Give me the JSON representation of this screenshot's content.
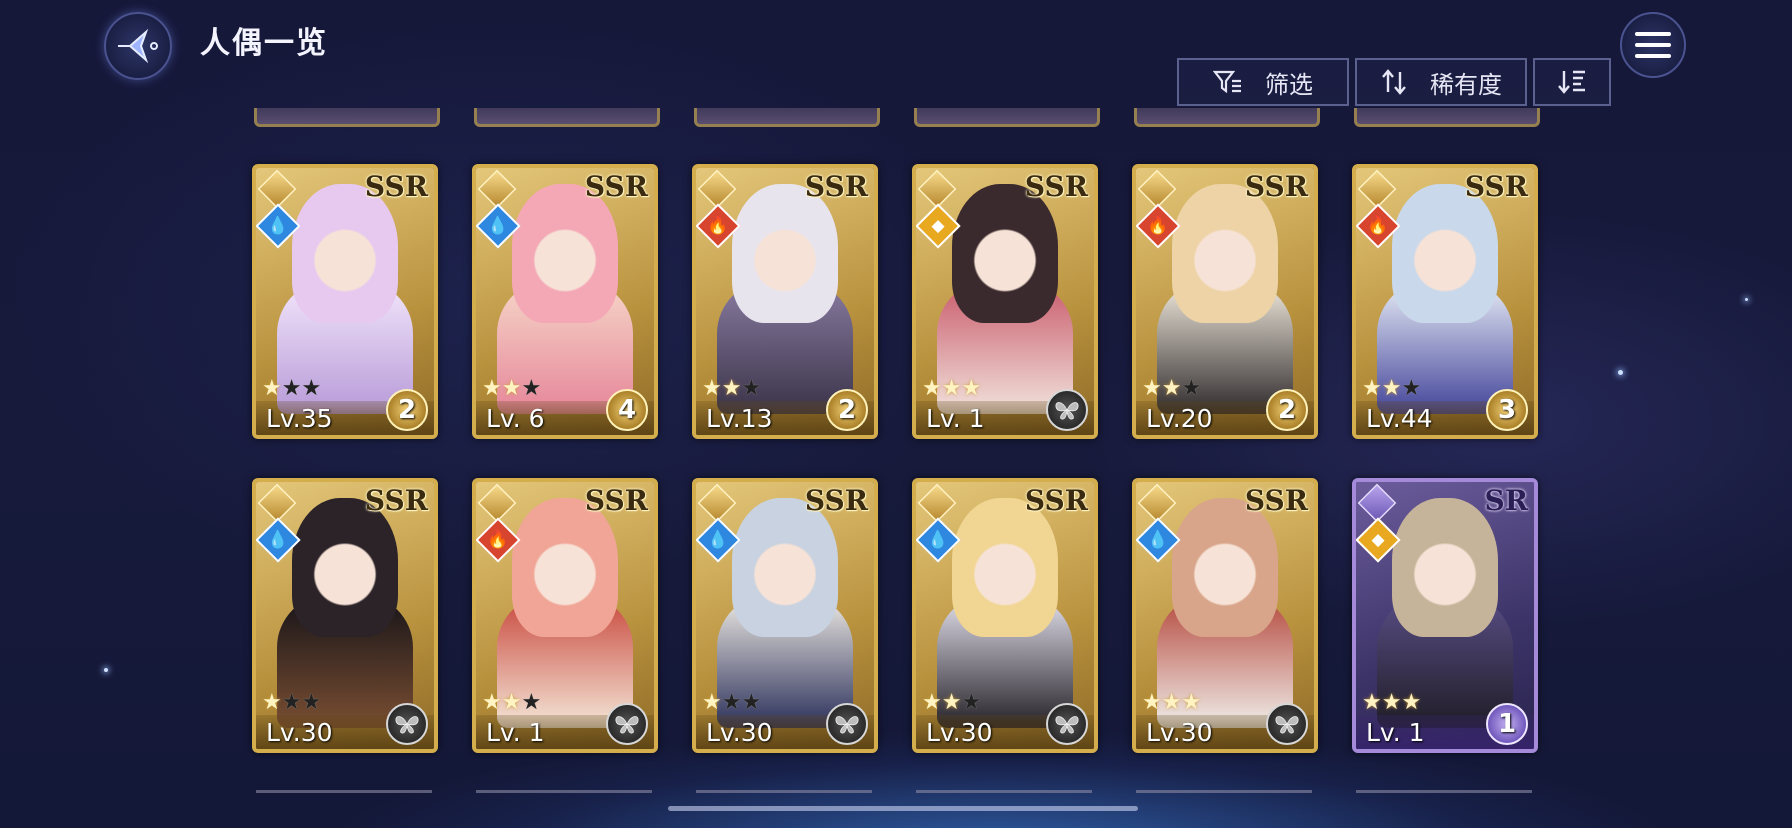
{
  "header": {
    "title": "人偶一览",
    "filter_label": "筛选",
    "sort_label": "稀有度"
  },
  "colors": {
    "ssr_frame": "#d4ae4d",
    "sr_frame": "#a48ad9",
    "water": "#2f88e0",
    "fire": "#d8452f",
    "light": "#e8a820"
  },
  "cards": [
    {
      "rarity": "SSR",
      "element": "water",
      "stars": 1,
      "max_stars": 3,
      "level": "Lv.35",
      "badge": "2",
      "badge_style": "gold",
      "palette": [
        "#e7c9f0",
        "#b79ad8",
        "#f3e7fb"
      ]
    },
    {
      "rarity": "SSR",
      "element": "water",
      "stars": 2,
      "max_stars": 3,
      "level": "Lv. 6",
      "badge": "4",
      "badge_style": "gold",
      "palette": [
        "#f4a8b6",
        "#e6869a",
        "#f6d7c8"
      ]
    },
    {
      "rarity": "SSR",
      "element": "fire",
      "stars": 2,
      "max_stars": 3,
      "level": "Lv.13",
      "badge": "2",
      "badge_style": "gold",
      "palette": [
        "#e8e4ee",
        "#3a3348",
        "#8a7ca2"
      ]
    },
    {
      "rarity": "SSR",
      "element": "light",
      "stars": 3,
      "max_stars": 3,
      "level": "Lv. 1",
      "badge": "",
      "badge_style": "gray",
      "palette": [
        "#3a2a2e",
        "#f1e3dc",
        "#c9596a"
      ]
    },
    {
      "rarity": "SSR",
      "element": "fire",
      "stars": 2,
      "max_stars": 3,
      "level": "Lv.20",
      "badge": "2",
      "badge_style": "gold",
      "palette": [
        "#edd3a5",
        "#2f2a2c",
        "#f4ede0"
      ]
    },
    {
      "rarity": "SSR",
      "element": "fire",
      "stars": 2,
      "max_stars": 3,
      "level": "Lv.44",
      "badge": "3",
      "badge_style": "gold",
      "palette": [
        "#c9d8ea",
        "#43449a",
        "#e9eef6"
      ]
    },
    {
      "rarity": "SSR",
      "element": "water",
      "stars": 1,
      "max_stars": 3,
      "level": "Lv.30",
      "badge": "",
      "badge_style": "gray",
      "palette": [
        "#2b2328",
        "#7a4e32",
        "#151318"
      ]
    },
    {
      "rarity": "SSR",
      "element": "fire",
      "stars": 2,
      "max_stars": 3,
      "level": "Lv. 1",
      "badge": "",
      "badge_style": "gray",
      "palette": [
        "#f0a596",
        "#f4e7d8",
        "#c8453a"
      ]
    },
    {
      "rarity": "SSR",
      "element": "water",
      "stars": 1,
      "max_stars": 3,
      "level": "Lv.30",
      "badge": "",
      "badge_style": "gray",
      "palette": [
        "#c8d2e0",
        "#2a2f5a",
        "#f2eee6"
      ]
    },
    {
      "rarity": "SSR",
      "element": "water",
      "stars": 2,
      "max_stars": 3,
      "level": "Lv.30",
      "badge": "",
      "badge_style": "gray",
      "palette": [
        "#f1d592",
        "#242027",
        "#e6e4f0"
      ]
    },
    {
      "rarity": "SSR",
      "element": "water",
      "stars": 3,
      "max_stars": 3,
      "level": "Lv.30",
      "badge": "",
      "badge_style": "gray",
      "palette": [
        "#d9a58a",
        "#f0eeea",
        "#b4463a"
      ]
    },
    {
      "rarity": "SR",
      "element": "light",
      "stars": 3,
      "max_stars": 3,
      "level": "Lv. 1",
      "badge": "1",
      "badge_style": "sr",
      "palette": [
        "#c6b49a",
        "#1f1d26",
        "#5a4e86"
      ]
    }
  ]
}
